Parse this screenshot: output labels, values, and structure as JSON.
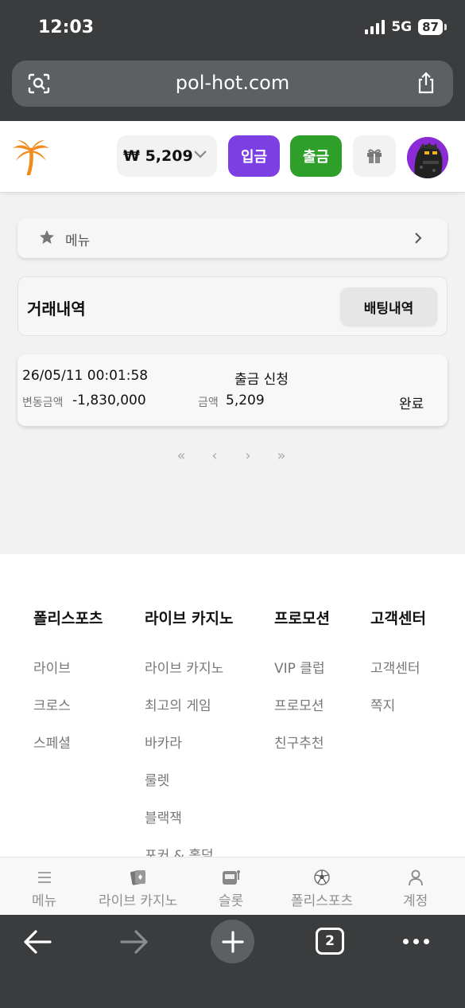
{
  "status_bar": {
    "time": "12:03",
    "network": "5G",
    "battery": "87"
  },
  "browser": {
    "url": "pol-hot.com",
    "tab_count": "2"
  },
  "header": {
    "balance": "₩ 5,209",
    "deposit_label": "입금",
    "withdraw_label": "출금",
    "colors": {
      "deposit": "#7b3fe4",
      "withdraw": "#2ea02a",
      "logo": "#f28a1c"
    }
  },
  "menu_bar": {
    "label": "메뉴"
  },
  "history": {
    "title": "거래내역",
    "betting_button": "배팅내역",
    "transactions": [
      {
        "datetime": "26/05/11 00:01:58",
        "type": "출금 신청",
        "change_label": "변동금액",
        "change_value": "-1,830,000",
        "amount_label": "금액",
        "amount_value": "5,209",
        "status": "완료"
      }
    ]
  },
  "pagination": {
    "first": "«",
    "prev": "‹",
    "next": "›",
    "last": "»"
  },
  "footer": {
    "columns": [
      {
        "heading": "폴리스포츠",
        "links": [
          "라이브",
          "크로스",
          "스페셜"
        ]
      },
      {
        "heading": "라이브 카지노",
        "links": [
          "라이브 카지노",
          "최고의 게임",
          "바카라",
          "룰렛",
          "블랙잭",
          "포커 & 홀덤"
        ]
      },
      {
        "heading": "프로모션",
        "links": [
          "VIP 클럽",
          "프로모션",
          "친구추천"
        ]
      },
      {
        "heading": "고객센터",
        "links": [
          "고객센터",
          "쪽지"
        ]
      }
    ]
  },
  "bottom_nav": {
    "items": [
      {
        "label": "메뉴",
        "icon": "menu-icon"
      },
      {
        "label": "라이브 카지노",
        "icon": "cards-icon"
      },
      {
        "label": "슬롯",
        "icon": "slot-machine-icon"
      },
      {
        "label": "폴리스포츠",
        "icon": "soccer-ball-icon"
      },
      {
        "label": "계정",
        "icon": "user-icon"
      }
    ]
  }
}
